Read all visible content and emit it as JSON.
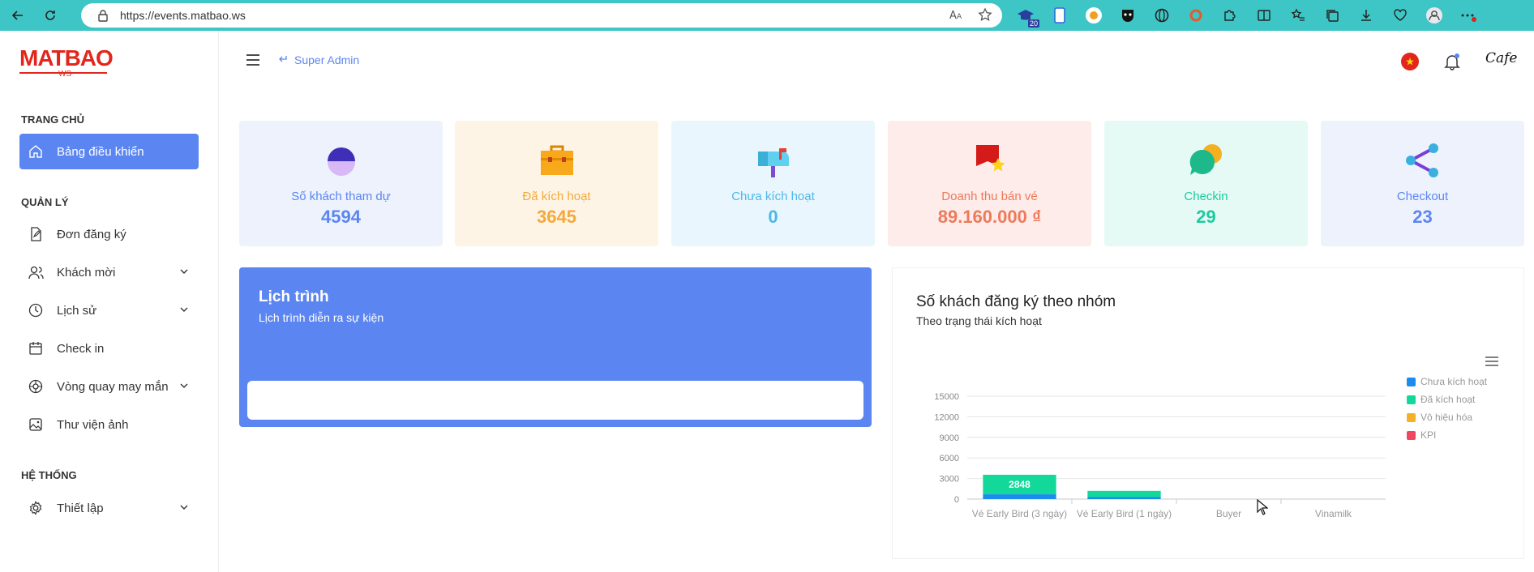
{
  "browser": {
    "url": "https://events.matbao.ws",
    "ext_badge": "20"
  },
  "sidebar": {
    "logo_main": "MATBAO",
    "logo_sub": "WS",
    "sections": [
      {
        "label": "TRANG CHỦ"
      },
      {
        "label": "QUẢN LÝ"
      },
      {
        "label": "HỆ THỐNG"
      }
    ],
    "items": [
      {
        "label": "Bảng điều khiển",
        "icon": "home-icon",
        "active": true
      },
      {
        "label": "Đơn đăng ký",
        "icon": "document-icon"
      },
      {
        "label": "Khách mời",
        "icon": "users-icon",
        "expandable": true
      },
      {
        "label": "Lịch sử",
        "icon": "clock-icon",
        "expandable": true
      },
      {
        "label": "Check in",
        "icon": "calendar-icon"
      },
      {
        "label": "Vòng quay may mắn",
        "icon": "wheel-icon",
        "expandable": true
      },
      {
        "label": "Thư viện ảnh",
        "icon": "image-icon"
      },
      {
        "label": "Thiết lập",
        "icon": "gear-icon",
        "expandable": true
      }
    ]
  },
  "header": {
    "breadcrumb": "Super Admin",
    "avatar_text": "Cafe"
  },
  "cards": [
    {
      "label": "Số khách tham dự",
      "value": "4594",
      "bg": "#eef2fd",
      "color": "#5b86f2",
      "icon": "person-icon"
    },
    {
      "label": "Đã kích hoạt",
      "value": "3645",
      "bg": "#fef4e5",
      "color": "#f4a93b",
      "icon": "briefcase-icon"
    },
    {
      "label": "Chưa kích hoạt",
      "value": "0",
      "bg": "#eaf6fd",
      "color": "#4bb8e8",
      "icon": "mailbox-icon"
    },
    {
      "label": "Doanh thu bán vé",
      "value": "89.160.000 ₫",
      "bg": "#fdece9",
      "color": "#ee7a5a",
      "icon": "flag-star-icon"
    },
    {
      "label": "Checkin",
      "value": "29",
      "bg": "#e6faf5",
      "color": "#1ccba0",
      "icon": "chat-icon"
    },
    {
      "label": "Checkout",
      "value": "23",
      "bg": "#eef2fd",
      "color": "#5b86f2",
      "icon": "share-icon"
    }
  ],
  "schedule": {
    "title": "Lịch trình",
    "subtitle": "Lịch trình diễn ra sự kiện"
  },
  "chart_panel": {
    "title": "Số khách đăng ký theo nhóm",
    "subtitle": "Theo trạng thái kích hoạt"
  },
  "chart_data": {
    "type": "bar",
    "stacked": true,
    "categories": [
      "Vé Early Bird (3 ngày)",
      "Vé Early Bird (1 ngày)",
      "Buyer",
      "Vinamilk"
    ],
    "series": [
      {
        "name": "Chưa kích hoạt",
        "color": "#1a8cf0",
        "values": [
          700,
          300,
          0,
          0
        ]
      },
      {
        "name": "Đã kích hoạt",
        "color": "#12d99a",
        "values": [
          2848,
          900,
          0,
          0
        ]
      },
      {
        "name": "Vô hiệu hóa",
        "color": "#f5b126",
        "values": [
          0,
          0,
          0,
          0
        ]
      },
      {
        "name": "KPI",
        "color": "#f0475f",
        "values": [
          0,
          0,
          0,
          0
        ]
      }
    ],
    "data_labels": [
      {
        "category": 0,
        "series": 1,
        "text": "2848"
      }
    ],
    "yticks": [
      0,
      3000,
      6000,
      9000,
      12000,
      15000
    ],
    "ylim": [
      0,
      15000
    ],
    "grid": true,
    "legend": "right"
  }
}
